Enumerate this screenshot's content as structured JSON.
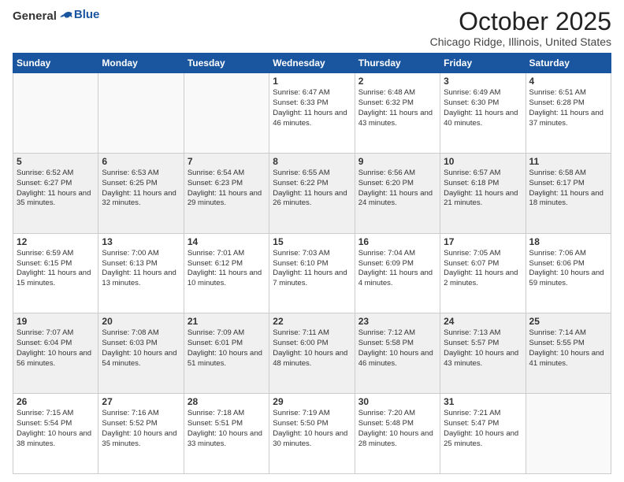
{
  "header": {
    "logo_general": "General",
    "logo_blue": "Blue",
    "month_title": "October 2025",
    "location": "Chicago Ridge, Illinois, United States"
  },
  "days_of_week": [
    "Sunday",
    "Monday",
    "Tuesday",
    "Wednesday",
    "Thursday",
    "Friday",
    "Saturday"
  ],
  "weeks": [
    [
      {
        "day": "",
        "info": ""
      },
      {
        "day": "",
        "info": ""
      },
      {
        "day": "",
        "info": ""
      },
      {
        "day": "1",
        "info": "Sunrise: 6:47 AM\nSunset: 6:33 PM\nDaylight: 11 hours and 46 minutes."
      },
      {
        "day": "2",
        "info": "Sunrise: 6:48 AM\nSunset: 6:32 PM\nDaylight: 11 hours and 43 minutes."
      },
      {
        "day": "3",
        "info": "Sunrise: 6:49 AM\nSunset: 6:30 PM\nDaylight: 11 hours and 40 minutes."
      },
      {
        "day": "4",
        "info": "Sunrise: 6:51 AM\nSunset: 6:28 PM\nDaylight: 11 hours and 37 minutes."
      }
    ],
    [
      {
        "day": "5",
        "info": "Sunrise: 6:52 AM\nSunset: 6:27 PM\nDaylight: 11 hours and 35 minutes."
      },
      {
        "day": "6",
        "info": "Sunrise: 6:53 AM\nSunset: 6:25 PM\nDaylight: 11 hours and 32 minutes."
      },
      {
        "day": "7",
        "info": "Sunrise: 6:54 AM\nSunset: 6:23 PM\nDaylight: 11 hours and 29 minutes."
      },
      {
        "day": "8",
        "info": "Sunrise: 6:55 AM\nSunset: 6:22 PM\nDaylight: 11 hours and 26 minutes."
      },
      {
        "day": "9",
        "info": "Sunrise: 6:56 AM\nSunset: 6:20 PM\nDaylight: 11 hours and 24 minutes."
      },
      {
        "day": "10",
        "info": "Sunrise: 6:57 AM\nSunset: 6:18 PM\nDaylight: 11 hours and 21 minutes."
      },
      {
        "day": "11",
        "info": "Sunrise: 6:58 AM\nSunset: 6:17 PM\nDaylight: 11 hours and 18 minutes."
      }
    ],
    [
      {
        "day": "12",
        "info": "Sunrise: 6:59 AM\nSunset: 6:15 PM\nDaylight: 11 hours and 15 minutes."
      },
      {
        "day": "13",
        "info": "Sunrise: 7:00 AM\nSunset: 6:13 PM\nDaylight: 11 hours and 13 minutes."
      },
      {
        "day": "14",
        "info": "Sunrise: 7:01 AM\nSunset: 6:12 PM\nDaylight: 11 hours and 10 minutes."
      },
      {
        "day": "15",
        "info": "Sunrise: 7:03 AM\nSunset: 6:10 PM\nDaylight: 11 hours and 7 minutes."
      },
      {
        "day": "16",
        "info": "Sunrise: 7:04 AM\nSunset: 6:09 PM\nDaylight: 11 hours and 4 minutes."
      },
      {
        "day": "17",
        "info": "Sunrise: 7:05 AM\nSunset: 6:07 PM\nDaylight: 11 hours and 2 minutes."
      },
      {
        "day": "18",
        "info": "Sunrise: 7:06 AM\nSunset: 6:06 PM\nDaylight: 10 hours and 59 minutes."
      }
    ],
    [
      {
        "day": "19",
        "info": "Sunrise: 7:07 AM\nSunset: 6:04 PM\nDaylight: 10 hours and 56 minutes."
      },
      {
        "day": "20",
        "info": "Sunrise: 7:08 AM\nSunset: 6:03 PM\nDaylight: 10 hours and 54 minutes."
      },
      {
        "day": "21",
        "info": "Sunrise: 7:09 AM\nSunset: 6:01 PM\nDaylight: 10 hours and 51 minutes."
      },
      {
        "day": "22",
        "info": "Sunrise: 7:11 AM\nSunset: 6:00 PM\nDaylight: 10 hours and 48 minutes."
      },
      {
        "day": "23",
        "info": "Sunrise: 7:12 AM\nSunset: 5:58 PM\nDaylight: 10 hours and 46 minutes."
      },
      {
        "day": "24",
        "info": "Sunrise: 7:13 AM\nSunset: 5:57 PM\nDaylight: 10 hours and 43 minutes."
      },
      {
        "day": "25",
        "info": "Sunrise: 7:14 AM\nSunset: 5:55 PM\nDaylight: 10 hours and 41 minutes."
      }
    ],
    [
      {
        "day": "26",
        "info": "Sunrise: 7:15 AM\nSunset: 5:54 PM\nDaylight: 10 hours and 38 minutes."
      },
      {
        "day": "27",
        "info": "Sunrise: 7:16 AM\nSunset: 5:52 PM\nDaylight: 10 hours and 35 minutes."
      },
      {
        "day": "28",
        "info": "Sunrise: 7:18 AM\nSunset: 5:51 PM\nDaylight: 10 hours and 33 minutes."
      },
      {
        "day": "29",
        "info": "Sunrise: 7:19 AM\nSunset: 5:50 PM\nDaylight: 10 hours and 30 minutes."
      },
      {
        "day": "30",
        "info": "Sunrise: 7:20 AM\nSunset: 5:48 PM\nDaylight: 10 hours and 28 minutes."
      },
      {
        "day": "31",
        "info": "Sunrise: 7:21 AM\nSunset: 5:47 PM\nDaylight: 10 hours and 25 minutes."
      },
      {
        "day": "",
        "info": ""
      }
    ]
  ]
}
